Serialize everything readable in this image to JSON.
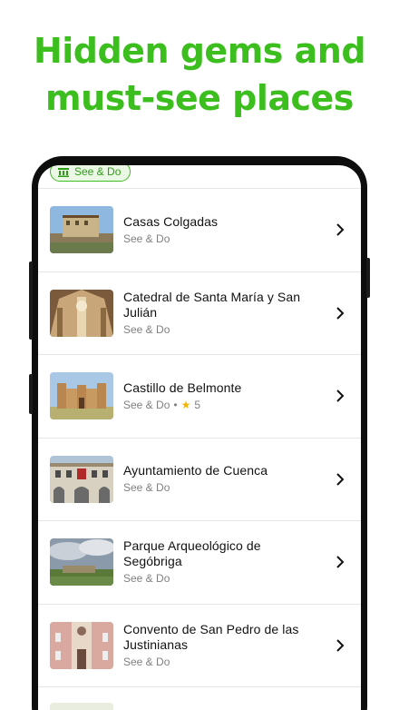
{
  "headline": {
    "line1": "Hidden gems and",
    "line2": "must-see places"
  },
  "filter_chip": {
    "label": "See & Do",
    "icon": "landmark-icon"
  },
  "places": [
    {
      "title": "Casas Colgadas",
      "category": "See & Do",
      "rating": null
    },
    {
      "title": "Catedral de Santa María y San Julián",
      "category": "See & Do",
      "rating": null
    },
    {
      "title": "Castillo de Belmonte",
      "category": "See & Do",
      "rating": "5"
    },
    {
      "title": "Ayuntamiento de Cuenca",
      "category": "See & Do",
      "rating": null
    },
    {
      "title": "Parque Arqueológico de Segóbriga",
      "category": "See & Do",
      "rating": null
    },
    {
      "title": "Convento de San Pedro de las Justinianas",
      "category": "See & Do",
      "rating": null
    }
  ],
  "colors": {
    "accent": "#3cbe1e",
    "star": "#f5b400"
  }
}
